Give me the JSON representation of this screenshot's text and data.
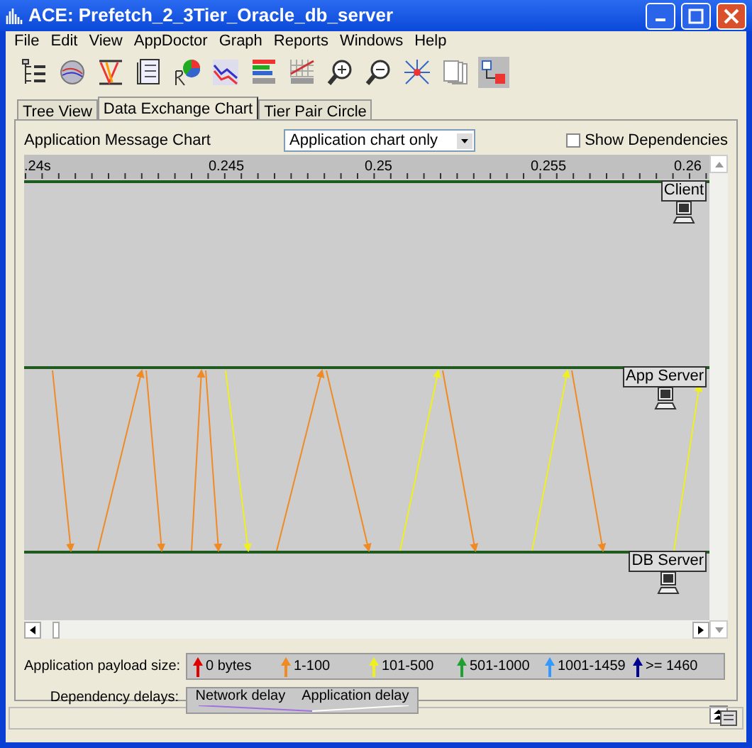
{
  "window": {
    "title": "ACE: Prefetch_2_3Tier_Oracle_db_server"
  },
  "menu": [
    "File",
    "Edit",
    "View",
    "AppDoctor",
    "Graph",
    "Reports",
    "Windows",
    "Help"
  ],
  "tabs": [
    {
      "label": "Tree View",
      "selected": false
    },
    {
      "label": "Data Exchange Chart",
      "selected": true
    },
    {
      "label": "Tier Pair Circle",
      "selected": false
    }
  ],
  "chart_panel": {
    "title": "Application Message Chart",
    "view_select": {
      "value": "Application chart only"
    },
    "show_dependencies": {
      "label": "Show Dependencies",
      "checked": false
    },
    "ruler_labels": [
      ".24s",
      "0.245",
      "0.25",
      "0.255",
      "0.26"
    ],
    "tiers": [
      {
        "label": "Client"
      },
      {
        "label": "App Server"
      },
      {
        "label": "DB Server"
      }
    ]
  },
  "payload_legend": {
    "label": "Application payload size:",
    "items": [
      {
        "label": "0 bytes",
        "color": "#e00000"
      },
      {
        "label": "1-100",
        "color": "#f08a24"
      },
      {
        "label": "101-500",
        "color": "#f0f020"
      },
      {
        "label": "501-1000",
        "color": "#20a030"
      },
      {
        "label": "1001-1459",
        "color": "#3399ff"
      },
      {
        "label": ">= 1460",
        "color": "#000090"
      }
    ]
  },
  "delay_legend": {
    "label": "Dependency delays:",
    "items": [
      "Network delay",
      "Application delay"
    ]
  }
}
